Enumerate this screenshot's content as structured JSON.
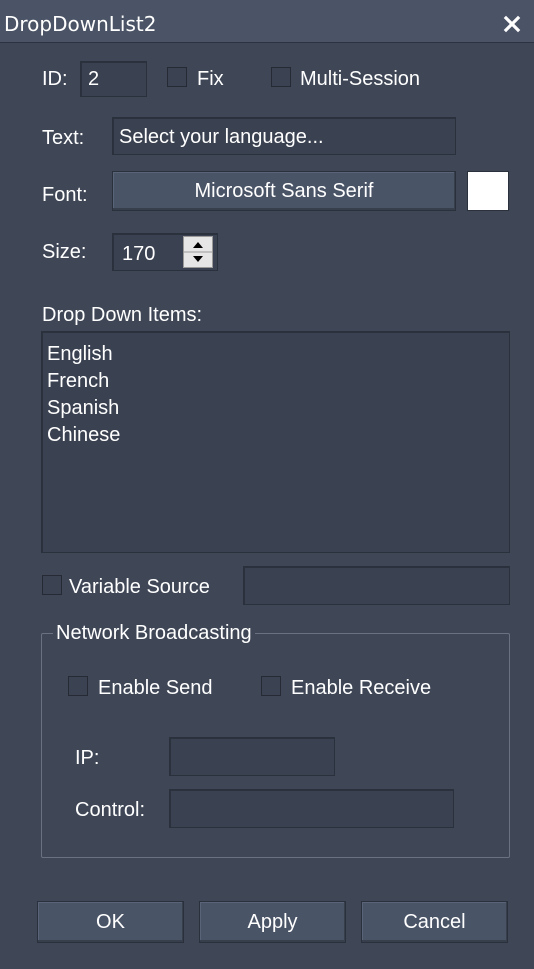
{
  "window": {
    "title": "DropDownList2",
    "close_icon": "close-icon"
  },
  "id_field": {
    "label": "ID:",
    "value": "2"
  },
  "fix": {
    "label": "Fix",
    "checked": false
  },
  "multi_session": {
    "label": "Multi-Session",
    "checked": false
  },
  "text_field": {
    "label": "Text:",
    "value": "Select your language..."
  },
  "font": {
    "label": "Font:",
    "value": "Microsoft Sans Serif",
    "color_swatch": "#ffffff"
  },
  "size": {
    "label": "Size:",
    "value": "170"
  },
  "drop_down": {
    "label": "Drop Down Items:",
    "items": [
      "English",
      "French",
      "Spanish",
      "Chinese"
    ]
  },
  "variable_source": {
    "label": "Variable Source",
    "checked": false,
    "value": ""
  },
  "network": {
    "group_label": "Network Broadcasting",
    "enable_send": {
      "label": "Enable Send",
      "checked": false
    },
    "enable_receive": {
      "label": "Enable Receive",
      "checked": false
    },
    "ip": {
      "label": "IP:",
      "value": ""
    },
    "control": {
      "label": "Control:",
      "value": ""
    }
  },
  "buttons": {
    "ok": "OK",
    "apply": "Apply",
    "cancel": "Cancel"
  },
  "colors": {
    "background": "#3f4757",
    "titlebar": "#4b5466",
    "field": "#3a4150",
    "button": "#4a5467"
  }
}
